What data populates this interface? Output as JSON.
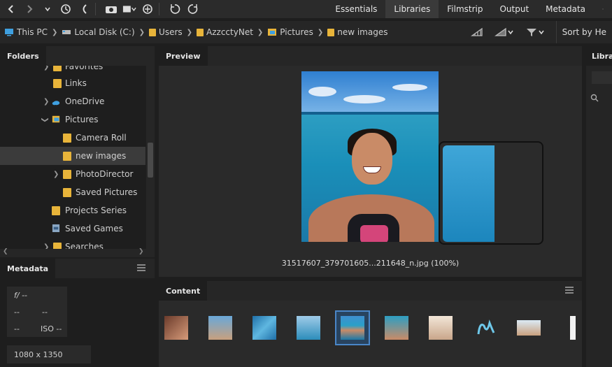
{
  "toolbar": {
    "icons": [
      "back-icon",
      "forward-icon",
      "dropdown-icon",
      "history-icon",
      "boomerang-icon",
      "camera-icon",
      "stack-icon",
      "rotate-icon",
      "rotate-ccw-icon",
      "rotate-cw-icon"
    ],
    "workspaces": [
      "Essentials",
      "Libraries",
      "Filmstrip",
      "Output",
      "Metadata"
    ],
    "active_workspace": "Libraries"
  },
  "path": {
    "crumbs": [
      "This PC",
      "Local Disk (C:)",
      "Users",
      "AzzcctyNet",
      "Pictures",
      "new images"
    ],
    "sort_label": "Sort by He"
  },
  "folders": {
    "tab": "Folders",
    "items": [
      {
        "label": "Favorites",
        "icon": "star-folder-icon"
      },
      {
        "label": "Links",
        "icon": "link-folder-icon"
      },
      {
        "label": "OneDrive",
        "icon": "cloud-icon"
      },
      {
        "label": "Pictures",
        "icon": "pictures-folder-icon"
      },
      {
        "label": "Camera Roll",
        "icon": "folder-icon"
      },
      {
        "label": "new images",
        "icon": "folder-icon"
      },
      {
        "label": "PhotoDirector",
        "icon": "folder-icon"
      },
      {
        "label": "Saved Pictures",
        "icon": "folder-icon"
      },
      {
        "label": "Projects Series",
        "icon": "folder-icon"
      },
      {
        "label": "Saved Games",
        "icon": "games-folder-icon"
      },
      {
        "label": "Searches",
        "icon": "search-folder-icon"
      }
    ],
    "selected": "new images"
  },
  "metadata": {
    "tab": "Metadata",
    "fstop": "f/ --",
    "shutter": "--",
    "ev": "--",
    "wb": "--",
    "iso_dash": "--",
    "iso": "ISO --",
    "dimensions": "1080 x 1350"
  },
  "preview": {
    "tab": "Preview",
    "filename": "31517607_379701605...211648_n.jpg (100%)"
  },
  "libraries": {
    "tab": "Libra"
  },
  "content": {
    "tab": "Content",
    "thumbs": [
      "thumb-1",
      "thumb-2",
      "thumb-3",
      "thumb-4",
      "thumb-5",
      "thumb-6",
      "thumb-7",
      "thumb-8",
      "thumb-9",
      "thumb-10"
    ],
    "selected_index": 4
  },
  "colors": {
    "accent_blue": "#4a86c8",
    "folder_yellow": "#e8b43a",
    "bg_dark": "#1e1e1e",
    "panel": "#2a2a2a"
  }
}
